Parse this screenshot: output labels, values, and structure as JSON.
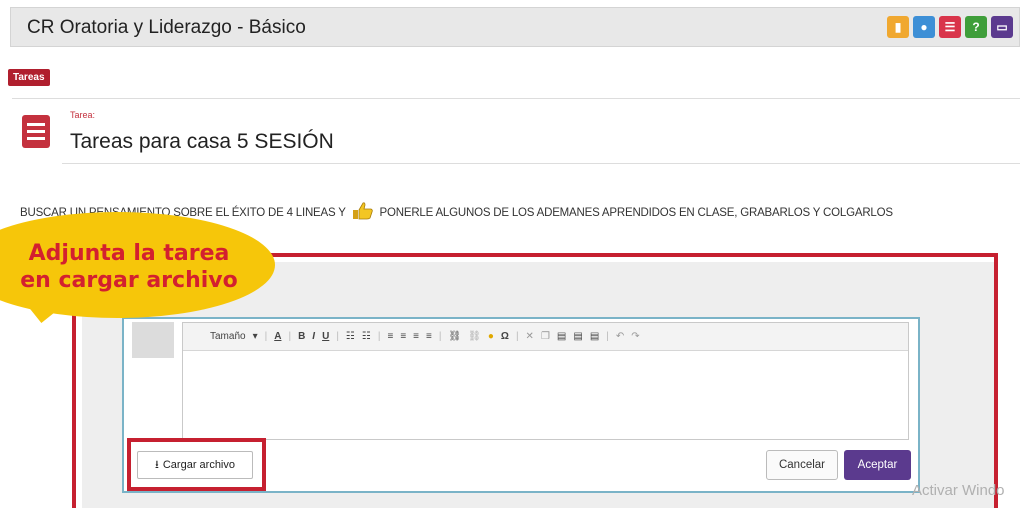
{
  "header": {
    "title": "CR Oratoria y Liderazgo - Básico",
    "icons": [
      {
        "name": "calendar-icon",
        "color": "#f0a830",
        "glyph": "▮"
      },
      {
        "name": "chat-icon",
        "color": "#3d8fd6",
        "glyph": "●"
      },
      {
        "name": "list-icon",
        "color": "#d9344a",
        "glyph": "☰"
      },
      {
        "name": "help-icon",
        "color": "#3f9e3a",
        "glyph": "?"
      },
      {
        "name": "screen-icon",
        "color": "#5b3a8e",
        "glyph": "▭"
      }
    ]
  },
  "tab": {
    "label": "Tareas"
  },
  "task": {
    "label": "Tarea:",
    "title": "Tareas para casa 5 SESIÓN"
  },
  "description": {
    "part1": "BUSCAR UN PENSAMIENTO SOBRE EL ÉXITO DE 4 LINEAS Y",
    "part2": "PONERLE ALGUNOS DE LOS ADEMANES APRENDIDOS EN CLASE, GRABARLOS Y COLGARLOS"
  },
  "callout": {
    "line1": "Adjunta la tarea",
    "line2": "en cargar archivo"
  },
  "editor": {
    "toolbar": {
      "size": "Tamaño"
    }
  },
  "buttons": {
    "upload": "Cargar archivo",
    "cancel": "Cancelar",
    "accept": "Aceptar"
  },
  "watermark": "Activar Windo",
  "colors": {
    "accent_red": "#c62030",
    "accept_purple": "#5b3a8e",
    "callout_yellow": "#f6c60a"
  }
}
